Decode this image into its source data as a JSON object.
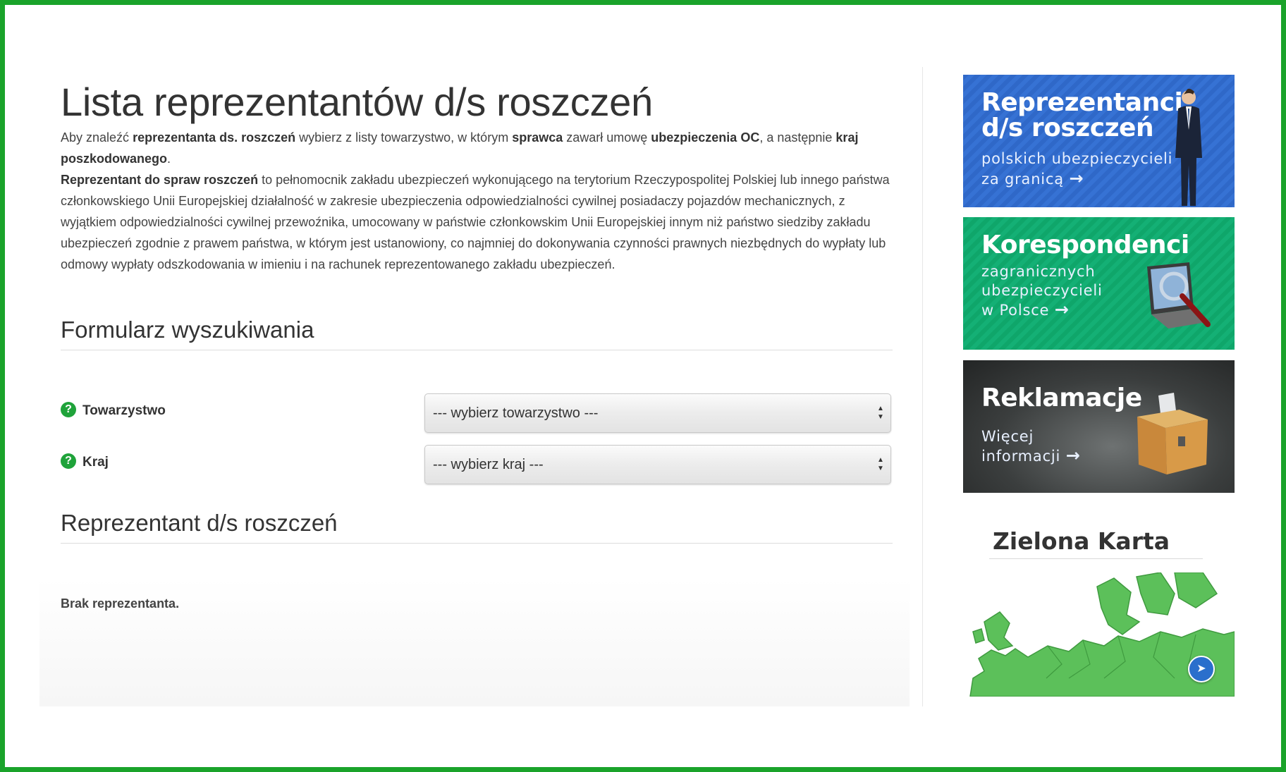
{
  "page": {
    "title": "Lista reprezentantów d/s roszczeń",
    "intro": {
      "p1": "Aby znaleźć ",
      "b1": "reprezentanta ds. roszczeń",
      "p2": " wybierz z listy towarzystwo, w którym ",
      "b2": "sprawca",
      "p3": " zawarł umowę ",
      "b3": "ubezpieczenia OC",
      "p4": ", a następnie ",
      "b4": "kraj poszkodowanego",
      "p5": "."
    },
    "definition": {
      "bold": "Reprezentant do spraw roszczeń",
      "text": " to pełnomocnik zakładu ubezpieczeń wykonującego na terytorium Rzeczypospolitej Polskiej lub innego państwa członkowskiego Unii Europejskiej działalność w zakresie ubezpieczenia odpowiedzialności cywilnej posiadaczy pojazdów mechanicznych, z wyjątkiem odpowiedzialności cywilnej przewoźnika, umocowany w państwie członkowskim Unii Europejskiej innym niż państwo siedziby zakładu ubezpieczeń zgodnie z prawem państwa, w którym jest ustanowiony, co najmniej do dokonywania czynności prawnych niezbędnych do wypłaty lub odmowy wypłaty odszkodowania w imieniu i na rachunek reprezentowanego zakładu ubezpieczeń."
    }
  },
  "search_form": {
    "heading": "Formularz wyszukiwania",
    "fields": [
      {
        "label": "Towarzystwo",
        "selected": "--- wybierz towarzystwo ---",
        "help_icon": "question-icon"
      },
      {
        "label": "Kraj",
        "selected": "--- wybierz kraj ---",
        "help_icon": "question-icon"
      }
    ]
  },
  "result": {
    "heading": "Reprezentant d/s roszczeń",
    "message": "Brak reprezentanta."
  },
  "sidebar": {
    "banners": [
      {
        "title_line1": "Reprezentanci",
        "title_line2": "d/s roszczeń",
        "sub_line1": "polskich ubezpieczycieli",
        "sub_line2": "za granicą",
        "arrow": "→",
        "color": "#3170d0"
      },
      {
        "title_line1": "Korespondenci",
        "sub_line1": "zagranicznych",
        "sub_line2": "ubezpieczycieli",
        "sub_line3": "w Polsce",
        "arrow": "→",
        "color": "#12ad72"
      },
      {
        "title_line1": "Reklamacje",
        "sub_line1": "Więcej",
        "sub_line2": "informacji",
        "arrow": "→",
        "color": "#3b3e3e"
      }
    ],
    "green_card": {
      "title": "Zielona Karta",
      "map_icon": "europe-map",
      "play_icon": "play-icon"
    }
  },
  "colors": {
    "frame": "#1aa32a",
    "help_icon": "#1fa33a",
    "map_green": "#5cc05a"
  }
}
